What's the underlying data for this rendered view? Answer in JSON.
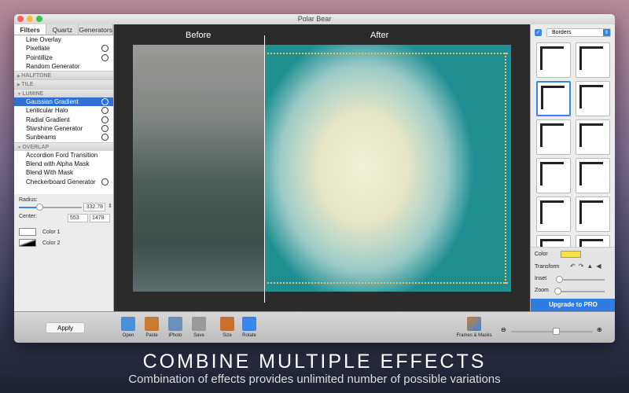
{
  "window": {
    "title": "Polar Bear"
  },
  "tabs": [
    "Filters",
    "Quartz",
    "Generators"
  ],
  "filters": {
    "top_items": [
      {
        "label": "Line Overlay",
        "gear": false
      },
      {
        "label": "Pixellate",
        "gear": true
      },
      {
        "label": "Pointillize",
        "gear": true
      },
      {
        "label": "Random Generator",
        "gear": false
      }
    ],
    "groups": {
      "halftone": "HALFTONE",
      "tile": "TILE",
      "lumine": "LUMINE",
      "overlap": "OVERLAP"
    },
    "lumine_items": [
      {
        "label": "Gaussian Gradient",
        "gear": true,
        "selected": true
      },
      {
        "label": "Lenticular Halo",
        "gear": true
      },
      {
        "label": "Radial Gradient",
        "gear": true
      },
      {
        "label": "Starshine Generator",
        "gear": true
      },
      {
        "label": "Sunbeams",
        "gear": true
      }
    ],
    "overlap_items": [
      {
        "label": "Accordion Ford Transition",
        "gear": false
      },
      {
        "label": "Blend with Alpha Mask",
        "gear": false
      },
      {
        "label": "Blend With Mask",
        "gear": false
      },
      {
        "label": "Checkerboard Generator",
        "gear": true
      }
    ]
  },
  "params": {
    "radius_label": "Radius:",
    "radius_value": "332.78",
    "radius_fraction": 0.33,
    "center_label": "Center:",
    "center_x": "553",
    "center_y": "1478",
    "color1": "Color 1",
    "color2": "Color 2"
  },
  "canvas": {
    "before": "Before",
    "after": "After"
  },
  "right": {
    "checked": true,
    "dropdown": "Borders",
    "color_label": "Color",
    "color_value": "#f5e04a",
    "transform_label": "Transform",
    "inset_label": "Inset",
    "zoom_label": "Zoom",
    "upgrade": "Upgrade to PRO"
  },
  "toolbar": {
    "apply": "Apply",
    "buttons": [
      "Open",
      "Paste",
      "iPhoto",
      "Save",
      "Size",
      "Rotate"
    ],
    "frames": "Frames & Masks",
    "zoom_level": 0.55
  },
  "caption": {
    "title": "COMBINE MULTIPLE EFFECTS",
    "subtitle": "Combination of effects provides unlimited number of possible variations"
  }
}
